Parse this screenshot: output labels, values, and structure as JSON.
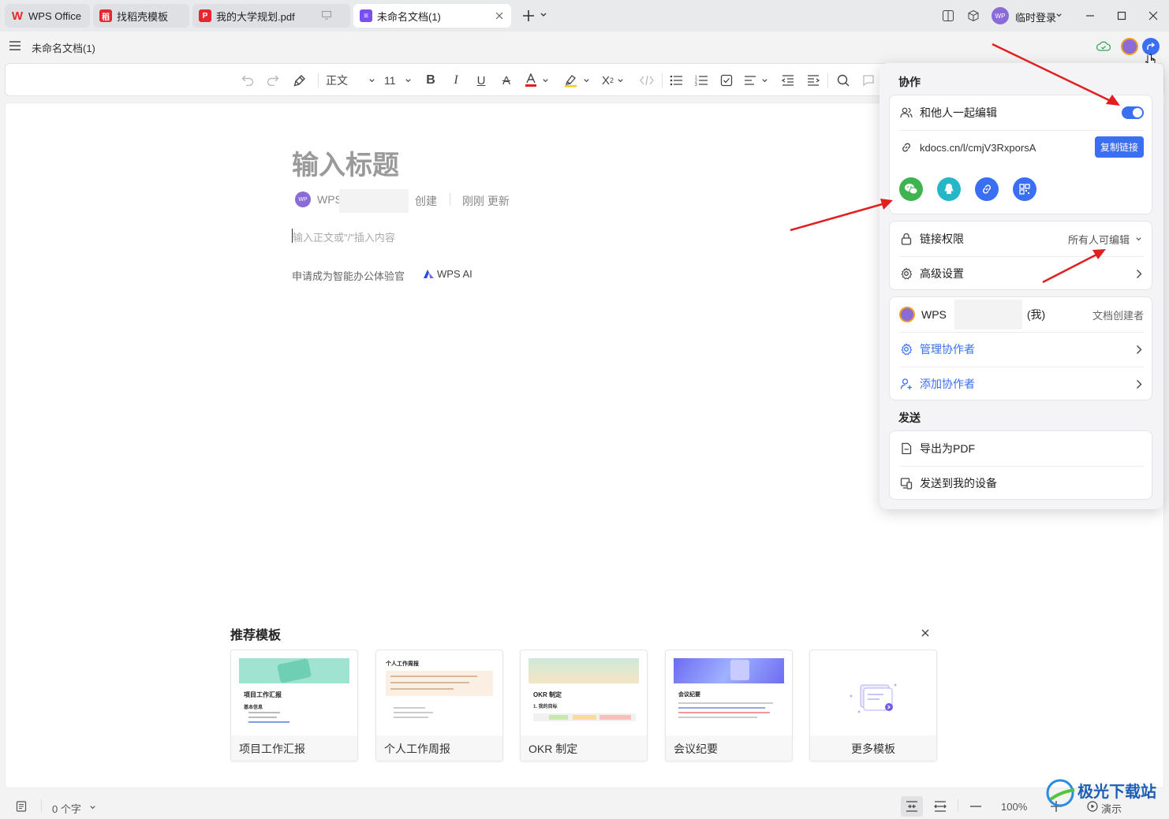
{
  "tabs": [
    {
      "label": "WPS Office"
    },
    {
      "label": "找稻壳模板"
    },
    {
      "label": "我的大学规划.pdf"
    },
    {
      "label": "未命名文档(1)"
    }
  ],
  "titlebar": {
    "user_label": "临时登录",
    "avatar_text": "WP"
  },
  "doc": {
    "name": "未命名文档(1)",
    "title_placeholder": "输入标题",
    "author_prefix": "WPS",
    "created_label": "创建",
    "updated_label": "刚刚 更新",
    "body_placeholder": "输入正文或\"/\"插入内容",
    "ai_prompt": "申请成为智能办公体验官",
    "ai_label": "WPS AI",
    "avatar_text": "WP"
  },
  "toolbar": {
    "style": "正文",
    "font_size": "11"
  },
  "templates": {
    "title": "推荐模板",
    "items": [
      {
        "label": "项目工作汇报",
        "thumb_title": "项目工作汇报",
        "thumb_sub": "基本信息"
      },
      {
        "label": "个人工作周报",
        "thumb_title": "个人工作周报",
        "thumb_sub": ""
      },
      {
        "label": "OKR 制定",
        "thumb_title": "OKR 制定",
        "thumb_sub": "1. 我的目标"
      },
      {
        "label": "会议纪要",
        "thumb_title": "会议纪要",
        "thumb_sub": ""
      },
      {
        "label": "更多模板"
      }
    ]
  },
  "panel": {
    "collab_title": "协作",
    "edit_together": "和他人一起编辑",
    "edit_together_on": true,
    "link": "kdocs.cn/l/cmjV3RxporsA",
    "copy_link": "复制链接",
    "permission_label": "链接权限",
    "permission_value": "所有人可编辑",
    "advanced": "高级设置",
    "owner_name": "WPS",
    "owner_me": "(我)",
    "owner_role": "文档创建者",
    "manage": "管理协作者",
    "add": "添加协作者",
    "send_title": "发送",
    "export_pdf": "导出为PDF",
    "send_device": "发送到我的设备"
  },
  "status": {
    "word_count": "0 个字",
    "zoom": "100%",
    "present": "演示"
  },
  "watermark": "极光下载站",
  "colors": {
    "accent": "#3a6ff2",
    "wechat": "#3fb34f",
    "qq": "#27b6c8",
    "arrow": "#e02020"
  }
}
